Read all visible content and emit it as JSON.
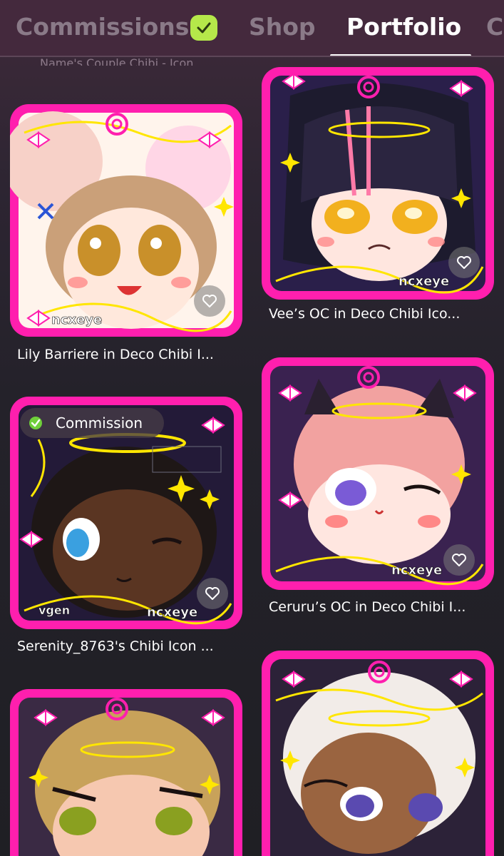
{
  "tabs": [
    {
      "label": "Commissions",
      "active": false,
      "verified_badge": true
    },
    {
      "label": "Shop",
      "active": false
    },
    {
      "label": "Portfolio",
      "active": true
    },
    {
      "label": "C",
      "active": false
    }
  ],
  "cut_text": "Name's Couple Chibi - Icon...",
  "portfolio": {
    "items": [
      {
        "title": "Lily Barriere in Deco Chibi I...",
        "signature": "ncxeye"
      },
      {
        "title": "Vee’s OC in Deco Chibi Ico...",
        "signature": "ncxeye"
      },
      {
        "title": "Serenity_8763's Chibi Icon ...",
        "signature": "ncxeye",
        "badge": "Commission",
        "watermark": "vgen"
      },
      {
        "title": "Ceruru’s OC in Deco Chibi I...",
        "signature": "ncxeye"
      },
      {
        "title": "",
        "signature": ""
      },
      {
        "title": "",
        "signature": ""
      }
    ]
  },
  "colors": {
    "accent_pink": "#ff1fae",
    "badge_green": "#b5e84a",
    "tab_active": "#ffffff",
    "tab_inactive": "#8a7a88"
  },
  "icons": {
    "verified": "check-badge-icon",
    "favorite": "heart-icon",
    "commission": "shield-check-icon"
  }
}
